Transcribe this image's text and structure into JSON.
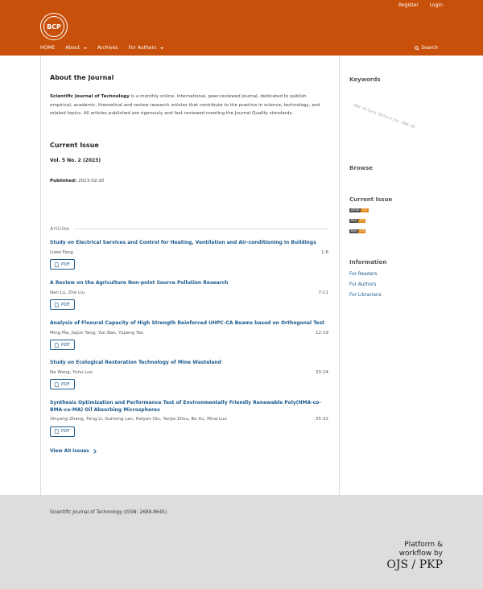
{
  "header": {
    "logo_text": "BCP",
    "user_nav": [
      "Register",
      "Login"
    ],
    "nav": [
      {
        "label": "HOME",
        "dropdown": false
      },
      {
        "label": "About",
        "dropdown": true
      },
      {
        "label": "Archives",
        "dropdown": false
      },
      {
        "label": "For Authors",
        "dropdown": true
      }
    ],
    "search_label": "Search",
    "brand_color": "#c8500a"
  },
  "about": {
    "title": "About the Journal",
    "journal_name": "Scientific Journal of Technology",
    "text": " is a monthly online, international, peer-reviewed journal, dedicated to publish empirical, academic, theoretical and review research articles that contribute to the practice in science, technology, and related topics. All articles published are rigorously and fast reviewed meeting the Journal Quality standards."
  },
  "current_issue": {
    "title": "Current Issue",
    "volume": "Vol. 5 No. 2 (2023)",
    "published_label": "Published:",
    "published_date": "2023-02-20"
  },
  "articles": {
    "heading": "Articles",
    "pdf_label": "PDF",
    "items": [
      {
        "title": "Study on Electrical Services and Control for Heating, Ventilation and Air-conditioning in Buildings",
        "authors": "Liwei Fang",
        "pages": "1-6"
      },
      {
        "title": "A Review on the Agriculture Non-point Source Pollution Research",
        "authors": "Nan Lu, Zhe Liu",
        "pages": "7-11"
      },
      {
        "title": "Analysis of Flexural Capacity of High Strength Reinforced UHPC-CA Beams based on Orthogonal Test",
        "authors": "Ming Ma, Jiajun Tang, Yun Bao, Yupeng Yao",
        "pages": "12-19"
      },
      {
        "title": "Study on Ecological Restoration Technology of Mine Wasteland",
        "authors": "Na Wang, Yuhu Luo",
        "pages": "20-24"
      },
      {
        "title": "Synthesis Optimization and Performance Test of Environmentally Friendly Renewable Poly(HMA-co-BMA-co-MA) Oil Absorbing Microspheres",
        "authors": "Xinyang Zhang, Feng Li, Guihong Lan, Haiyan Qiu, Yanjia Zhou, Bo Xu, Mina Luo",
        "pages": "25-32"
      }
    ],
    "view_all": "View All Issues"
  },
  "sidebar": {
    "keywords_title": "Keywords",
    "keywords_cloud": "HHd Attack Detection CNN-SA",
    "browse_title": "Browse",
    "current_issue_title": "Current Issue",
    "feeds": [
      {
        "left": "ATOM",
        "right": "1.0",
        "color": "#e08a1e"
      },
      {
        "left": "RSS",
        "right": "2.0",
        "color": "#e08a1e"
      },
      {
        "left": "RSS",
        "right": "1.0",
        "color": "#e08a1e"
      }
    ],
    "information_title": "Information",
    "info_links": [
      "For Readers",
      "For Authors",
      "For Librarians"
    ]
  },
  "footer": {
    "text": "Scientific Journal of Technology (ISSN: 2688-8645)",
    "pkp_line1": "Platform &",
    "pkp_line2": "workflow by",
    "pkp_line3": "OJS / PKP"
  }
}
